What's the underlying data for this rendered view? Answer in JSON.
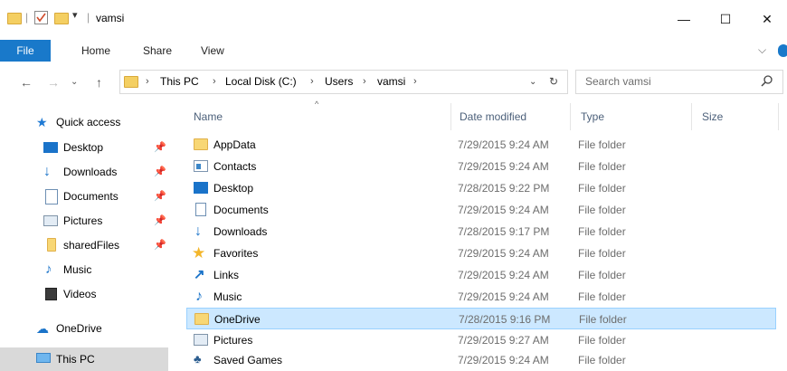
{
  "window": {
    "title": "vamsi",
    "minimize": "—",
    "maximize": "☐",
    "close": "✕"
  },
  "ribbon": {
    "tabs": [
      "File",
      "Home",
      "Share",
      "View"
    ]
  },
  "address": {
    "crumbs": [
      "This PC",
      "Local Disk (C:)",
      "Users",
      "vamsi"
    ],
    "search_placeholder": "Search vamsi"
  },
  "nav": {
    "quick_access": "Quick access",
    "items": [
      {
        "label": "Desktop",
        "pinned": true,
        "icon": "desktop-icon"
      },
      {
        "label": "Downloads",
        "pinned": true,
        "icon": "download-arrow-icon"
      },
      {
        "label": "Documents",
        "pinned": true,
        "icon": "document-icon"
      },
      {
        "label": "Pictures",
        "pinned": true,
        "icon": "pictures-icon"
      },
      {
        "label": "sharedFiles",
        "pinned": true,
        "icon": "folder-icon"
      },
      {
        "label": "Music",
        "pinned": false,
        "icon": "music-note-icon"
      },
      {
        "label": "Videos",
        "pinned": false,
        "icon": "film-icon"
      }
    ],
    "onedrive": "OneDrive",
    "this_pc": "This PC"
  },
  "columns": {
    "name": "Name",
    "date": "Date modified",
    "type": "Type",
    "size": "Size"
  },
  "files": [
    {
      "name": "AppData",
      "date": "7/29/2015 9:24 AM",
      "type": "File folder",
      "icon": "folder-icon"
    },
    {
      "name": "Contacts",
      "date": "7/29/2015 9:24 AM",
      "type": "File folder",
      "icon": "contacts-icon"
    },
    {
      "name": "Desktop",
      "date": "7/28/2015 9:22 PM",
      "type": "File folder",
      "icon": "desktop-icon"
    },
    {
      "name": "Documents",
      "date": "7/29/2015 9:24 AM",
      "type": "File folder",
      "icon": "document-icon"
    },
    {
      "name": "Downloads",
      "date": "7/28/2015 9:17 PM",
      "type": "File folder",
      "icon": "download-arrow-icon"
    },
    {
      "name": "Favorites",
      "date": "7/29/2015 9:24 AM",
      "type": "File folder",
      "icon": "star-icon"
    },
    {
      "name": "Links",
      "date": "7/29/2015 9:24 AM",
      "type": "File folder",
      "icon": "links-arrow-icon"
    },
    {
      "name": "Music",
      "date": "7/29/2015 9:24 AM",
      "type": "File folder",
      "icon": "music-note-icon"
    },
    {
      "name": "OneDrive",
      "date": "7/28/2015 9:16 PM",
      "type": "File folder",
      "icon": "folder-icon",
      "selected": true
    },
    {
      "name": "Pictures",
      "date": "7/29/2015 9:27 AM",
      "type": "File folder",
      "icon": "pictures-icon"
    },
    {
      "name": "Saved Games",
      "date": "7/29/2015 9:24 AM",
      "type": "File folder",
      "icon": "saved-games-icon"
    }
  ]
}
